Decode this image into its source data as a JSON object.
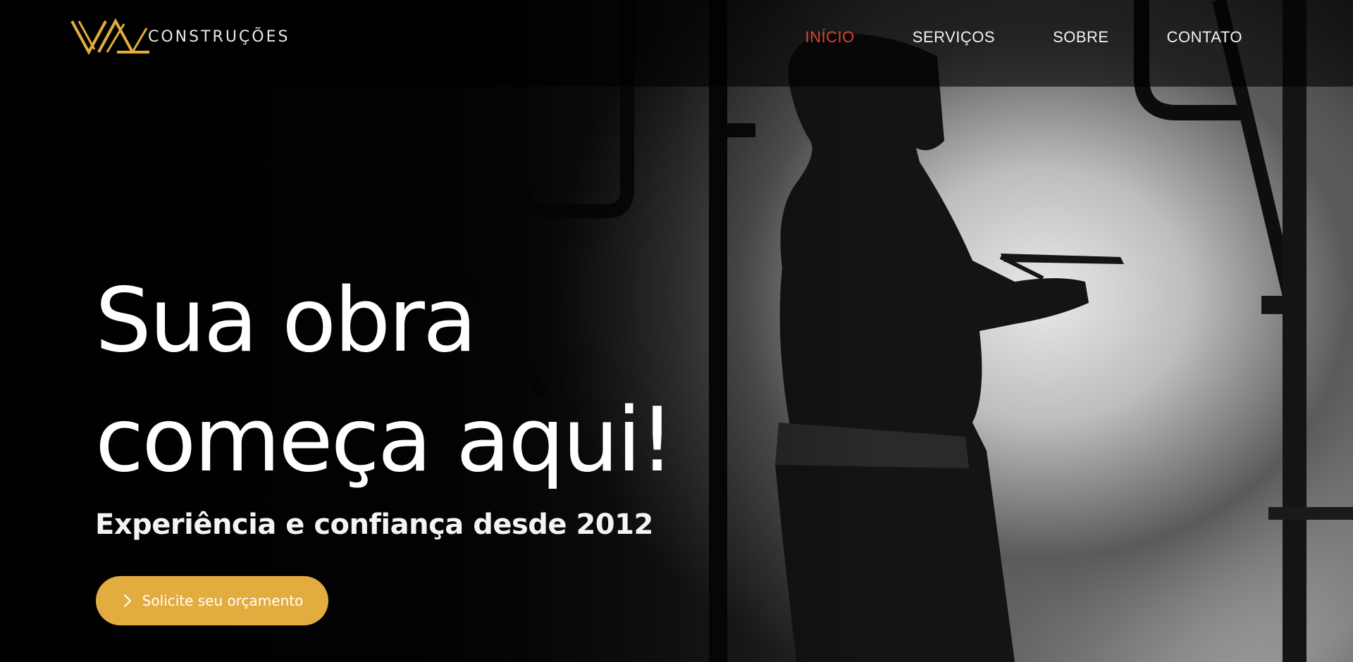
{
  "header": {
    "logo_text": "CONSTRUÇÕES",
    "nav": [
      {
        "label": "INÍCIO",
        "active": true
      },
      {
        "label": "SERVIÇOS",
        "active": false
      },
      {
        "label": "SOBRE",
        "active": false
      },
      {
        "label": "CONTATO",
        "active": false
      }
    ]
  },
  "hero": {
    "headline_line1": "Sua obra",
    "headline_line2": "começa aqui!",
    "subheadline": "Experiência e confiança desde 2012",
    "cta_label": "Solicite seu orçamento"
  },
  "colors": {
    "accent": "#e3ac3f",
    "nav_active": "#d9472d",
    "text": "#ffffff"
  },
  "icons": {
    "logo": "vm-logo-mark",
    "cta": "chevron-right-icon"
  }
}
